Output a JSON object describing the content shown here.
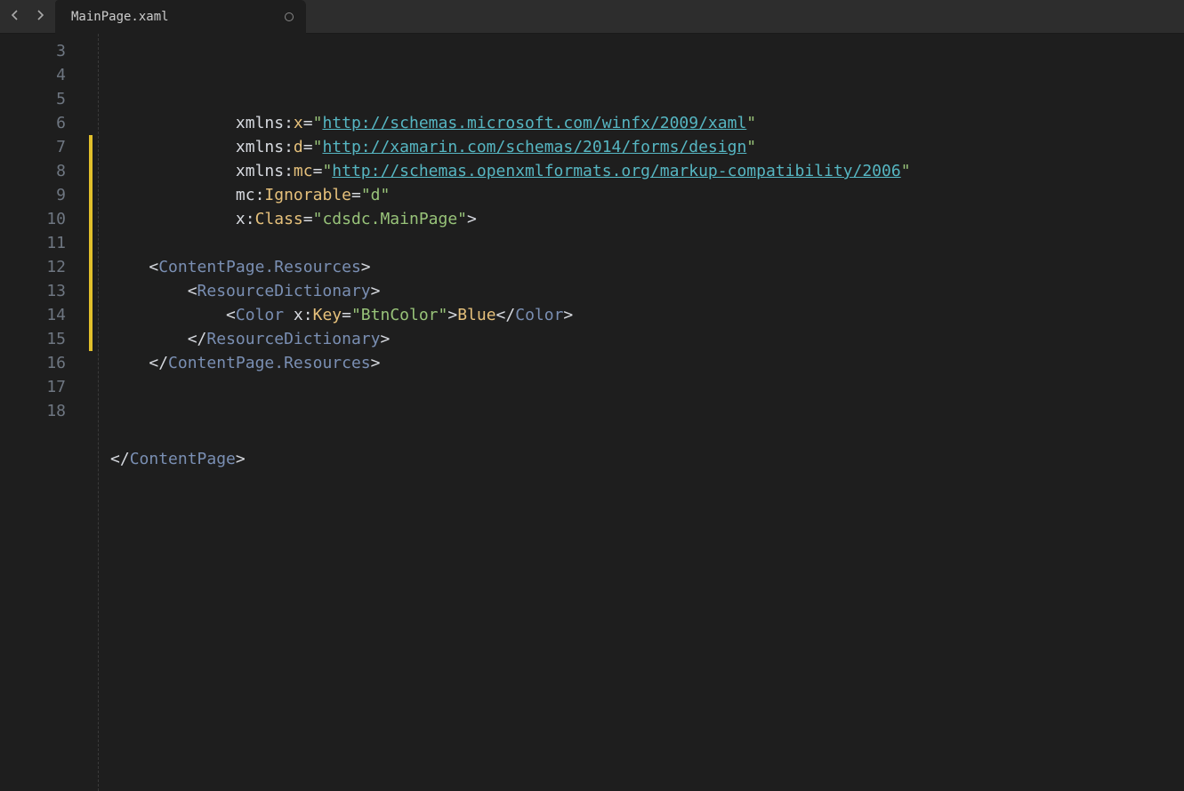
{
  "tab": {
    "title": "MainPage.xaml"
  },
  "gutter": {
    "start": 3,
    "end": 18,
    "modified": [
      7,
      8,
      9,
      10,
      11,
      12,
      13,
      14,
      15
    ]
  },
  "code": {
    "l3": {
      "indent": "             ",
      "attr_ns": "xmlns",
      "colon": ":",
      "attr": "x",
      "eq": "=",
      "q1": "\"",
      "url": "http://schemas.microsoft.com/winfx/2009/xaml",
      "q2": "\""
    },
    "l4": {
      "indent": "             ",
      "attr_ns": "xmlns",
      "colon": ":",
      "attr": "d",
      "eq": "=",
      "q1": "\"",
      "url": "http://xamarin.com/schemas/2014/forms/design",
      "q2": "\""
    },
    "l5": {
      "indent": "             ",
      "attr_ns": "xmlns",
      "colon": ":",
      "attr": "mc",
      "eq": "=",
      "q1": "\"",
      "url": "http://schemas.openxmlformats.org/markup-compatibility/2006",
      "q2": "\""
    },
    "l6": {
      "indent": "             ",
      "attr_ns": "mc",
      "colon": ":",
      "attr": "Ignorable",
      "eq": "=",
      "val": "\"d\""
    },
    "l7": {
      "indent": "             ",
      "attr_ns": "x",
      "colon": ":",
      "attr": "Class",
      "eq": "=",
      "val": "\"cdsdc.MainPage\"",
      "close": ">"
    },
    "l8": {
      "text": ""
    },
    "l9": {
      "indent": "    ",
      "open": "<",
      "tag": "ContentPage.Resources",
      "close": ">"
    },
    "l10": {
      "indent": "        ",
      "open": "<",
      "tag": "ResourceDictionary",
      "close": ">"
    },
    "l11": {
      "indent": "            ",
      "open": "<",
      "tag_open": "Color",
      "sp": " ",
      "attr_ns": "x",
      "colon": ":",
      "attr": "Key",
      "eq": "=",
      "val": "\"BtnColor\"",
      "gt": ">",
      "text": "Blue",
      "open2": "</",
      "tag_close": "Color",
      "close2": ">"
    },
    "l12": {
      "indent": "        ",
      "open": "</",
      "tag": "ResourceDictionary",
      "close": ">"
    },
    "l13": {
      "indent": "    ",
      "open": "</",
      "tag": "ContentPage.Resources",
      "close": ">"
    },
    "l14": {
      "text": ""
    },
    "l15": {
      "text": ""
    },
    "l16": {
      "text": ""
    },
    "l17": {
      "indent": "",
      "open": "</",
      "tag": "ContentPage",
      "close": ">"
    },
    "l18": {
      "text": ""
    }
  }
}
